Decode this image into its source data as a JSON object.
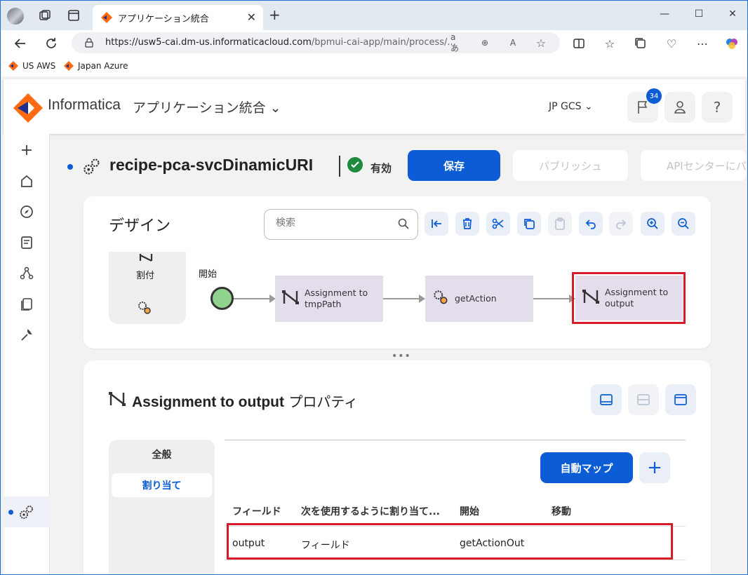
{
  "browser": {
    "tab_title": "アプリケーション統合",
    "url_domain": "https://usw5-cai.dm-us.informaticacloud.com",
    "url_path": "/bpmui-cai-app/main/process/...",
    "bookmarks": [
      "US AWS",
      "Japan Azure"
    ]
  },
  "header": {
    "brand": "Informatica",
    "app_name": "アプリケーション統合",
    "org": "JP GCS",
    "notifications_count": "34",
    "help_label": "?"
  },
  "process": {
    "name": "recipe-pca-svcDinamicURI",
    "status": "有効",
    "save_label": "保存",
    "publish_label": "パブリッシュ",
    "api_center_label": "APIセンターにパ"
  },
  "design": {
    "title": "デザイン",
    "search_placeholder": "検索",
    "palette_label": "割付",
    "start_label": "開始",
    "nodes": [
      {
        "line1": "Assignment to",
        "line2": "tmpPath"
      },
      {
        "line1": "getAction",
        "line2": ""
      },
      {
        "line1": "Assignment to",
        "line2": "output"
      }
    ]
  },
  "properties": {
    "title_bold": "Assignment to output",
    "title_suffix": "プロパティ",
    "tabs": [
      "全般",
      "割り当て"
    ],
    "auto_map_label": "自動マップ",
    "columns": [
      "フィールド",
      "次を使用するように割り当て...",
      "開始",
      "移動"
    ],
    "rows": [
      {
        "field": "output",
        "assign_using": "フィールド",
        "from": "getActionOut",
        "move": ""
      }
    ]
  },
  "colors": {
    "accent": "#0b5cd5",
    "highlight": "#d81b2a",
    "node_fill": "#e4deec",
    "start_fill": "#8fd38f"
  }
}
